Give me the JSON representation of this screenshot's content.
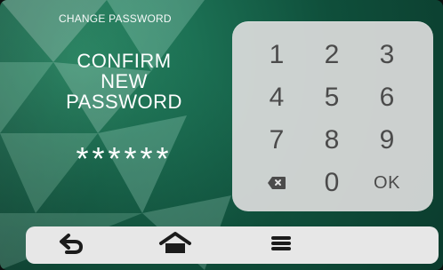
{
  "header": {
    "title": "CHANGE PASSWORD"
  },
  "prompt": {
    "line1": "CONFIRM",
    "line2": "NEW",
    "line3": "PASSWORD"
  },
  "password": {
    "masked_value": "******"
  },
  "keypad": {
    "k1": "1",
    "k2": "2",
    "k3": "3",
    "k4": "4",
    "k5": "5",
    "k6": "6",
    "k7": "7",
    "k8": "8",
    "k9": "9",
    "k0": "0",
    "ok": "OK",
    "backspace_icon": "backspace-icon"
  },
  "bottom_bar": {
    "back_icon": "back-icon",
    "home_icon": "home-icon",
    "menu_icon": "menu-icon"
  }
}
